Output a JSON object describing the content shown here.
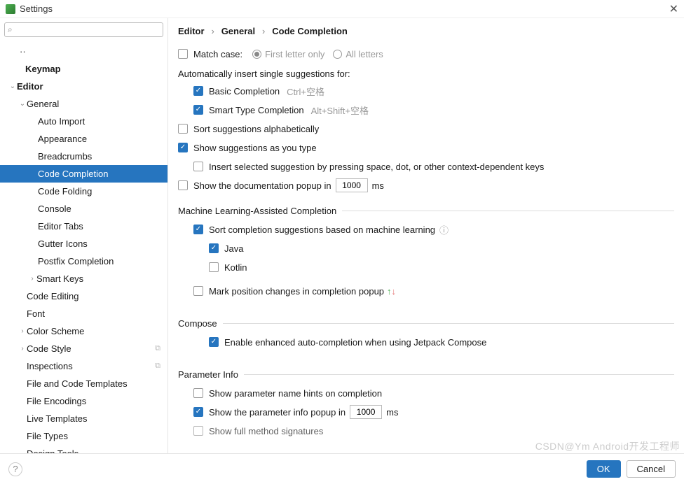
{
  "window": {
    "title": "Settings",
    "close": "✕"
  },
  "search": {
    "placeholder": ""
  },
  "tree": {
    "dots": "··",
    "keymap": "Keymap",
    "editor": "Editor",
    "general": "General",
    "auto_import": "Auto Import",
    "appearance": "Appearance",
    "breadcrumbs": "Breadcrumbs",
    "code_completion": "Code Completion",
    "code_folding": "Code Folding",
    "console": "Console",
    "editor_tabs": "Editor Tabs",
    "gutter_icons": "Gutter Icons",
    "postfix": "Postfix Completion",
    "smart_keys": "Smart Keys",
    "code_editing": "Code Editing",
    "font": "Font",
    "color_scheme": "Color Scheme",
    "code_style": "Code Style",
    "inspections": "Inspections",
    "file_code_tpl": "File and Code Templates",
    "file_encodings": "File Encodings",
    "live_templates": "Live Templates",
    "file_types": "File Types",
    "design_tools": "Design Tools"
  },
  "crumb": {
    "a": "Editor",
    "b": "General",
    "c": "Code Completion",
    "sep": "›"
  },
  "opts": {
    "match_case": "Match case:",
    "first_letter": "First letter only",
    "all_letters": "All letters",
    "auto_insert": "Automatically insert single suggestions for:",
    "basic": "Basic Completion",
    "basic_sc": "Ctrl+空格",
    "smart": "Smart Type Completion",
    "smart_sc": "Alt+Shift+空格",
    "sort_alpha": "Sort suggestions alphabetically",
    "as_type": "Show suggestions as you type",
    "insert_space": "Insert selected suggestion by pressing space, dot, or other context-dependent keys",
    "doc_popup_a": "Show the documentation popup in",
    "doc_popup_val": "1000",
    "ms": "ms",
    "ml_head": "Machine Learning-Assisted Completion",
    "ml_sort": "Sort completion suggestions based on machine learning",
    "java": "Java",
    "kotlin": "Kotlin",
    "mark_pos": "Mark position changes in completion popup",
    "compose_head": "Compose",
    "compose_enable": "Enable enhanced auto-completion when using Jetpack Compose",
    "param_head": "Parameter Info",
    "param_hints": "Show parameter name hints on completion",
    "param_popup_a": "Show the parameter info popup in",
    "param_popup_val": "1000",
    "full_sig": "Show full method signatures"
  },
  "footer": {
    "help": "?",
    "ok": "OK",
    "cancel": "Cancel"
  },
  "watermark": "CSDN@Ym Android开发工程师"
}
